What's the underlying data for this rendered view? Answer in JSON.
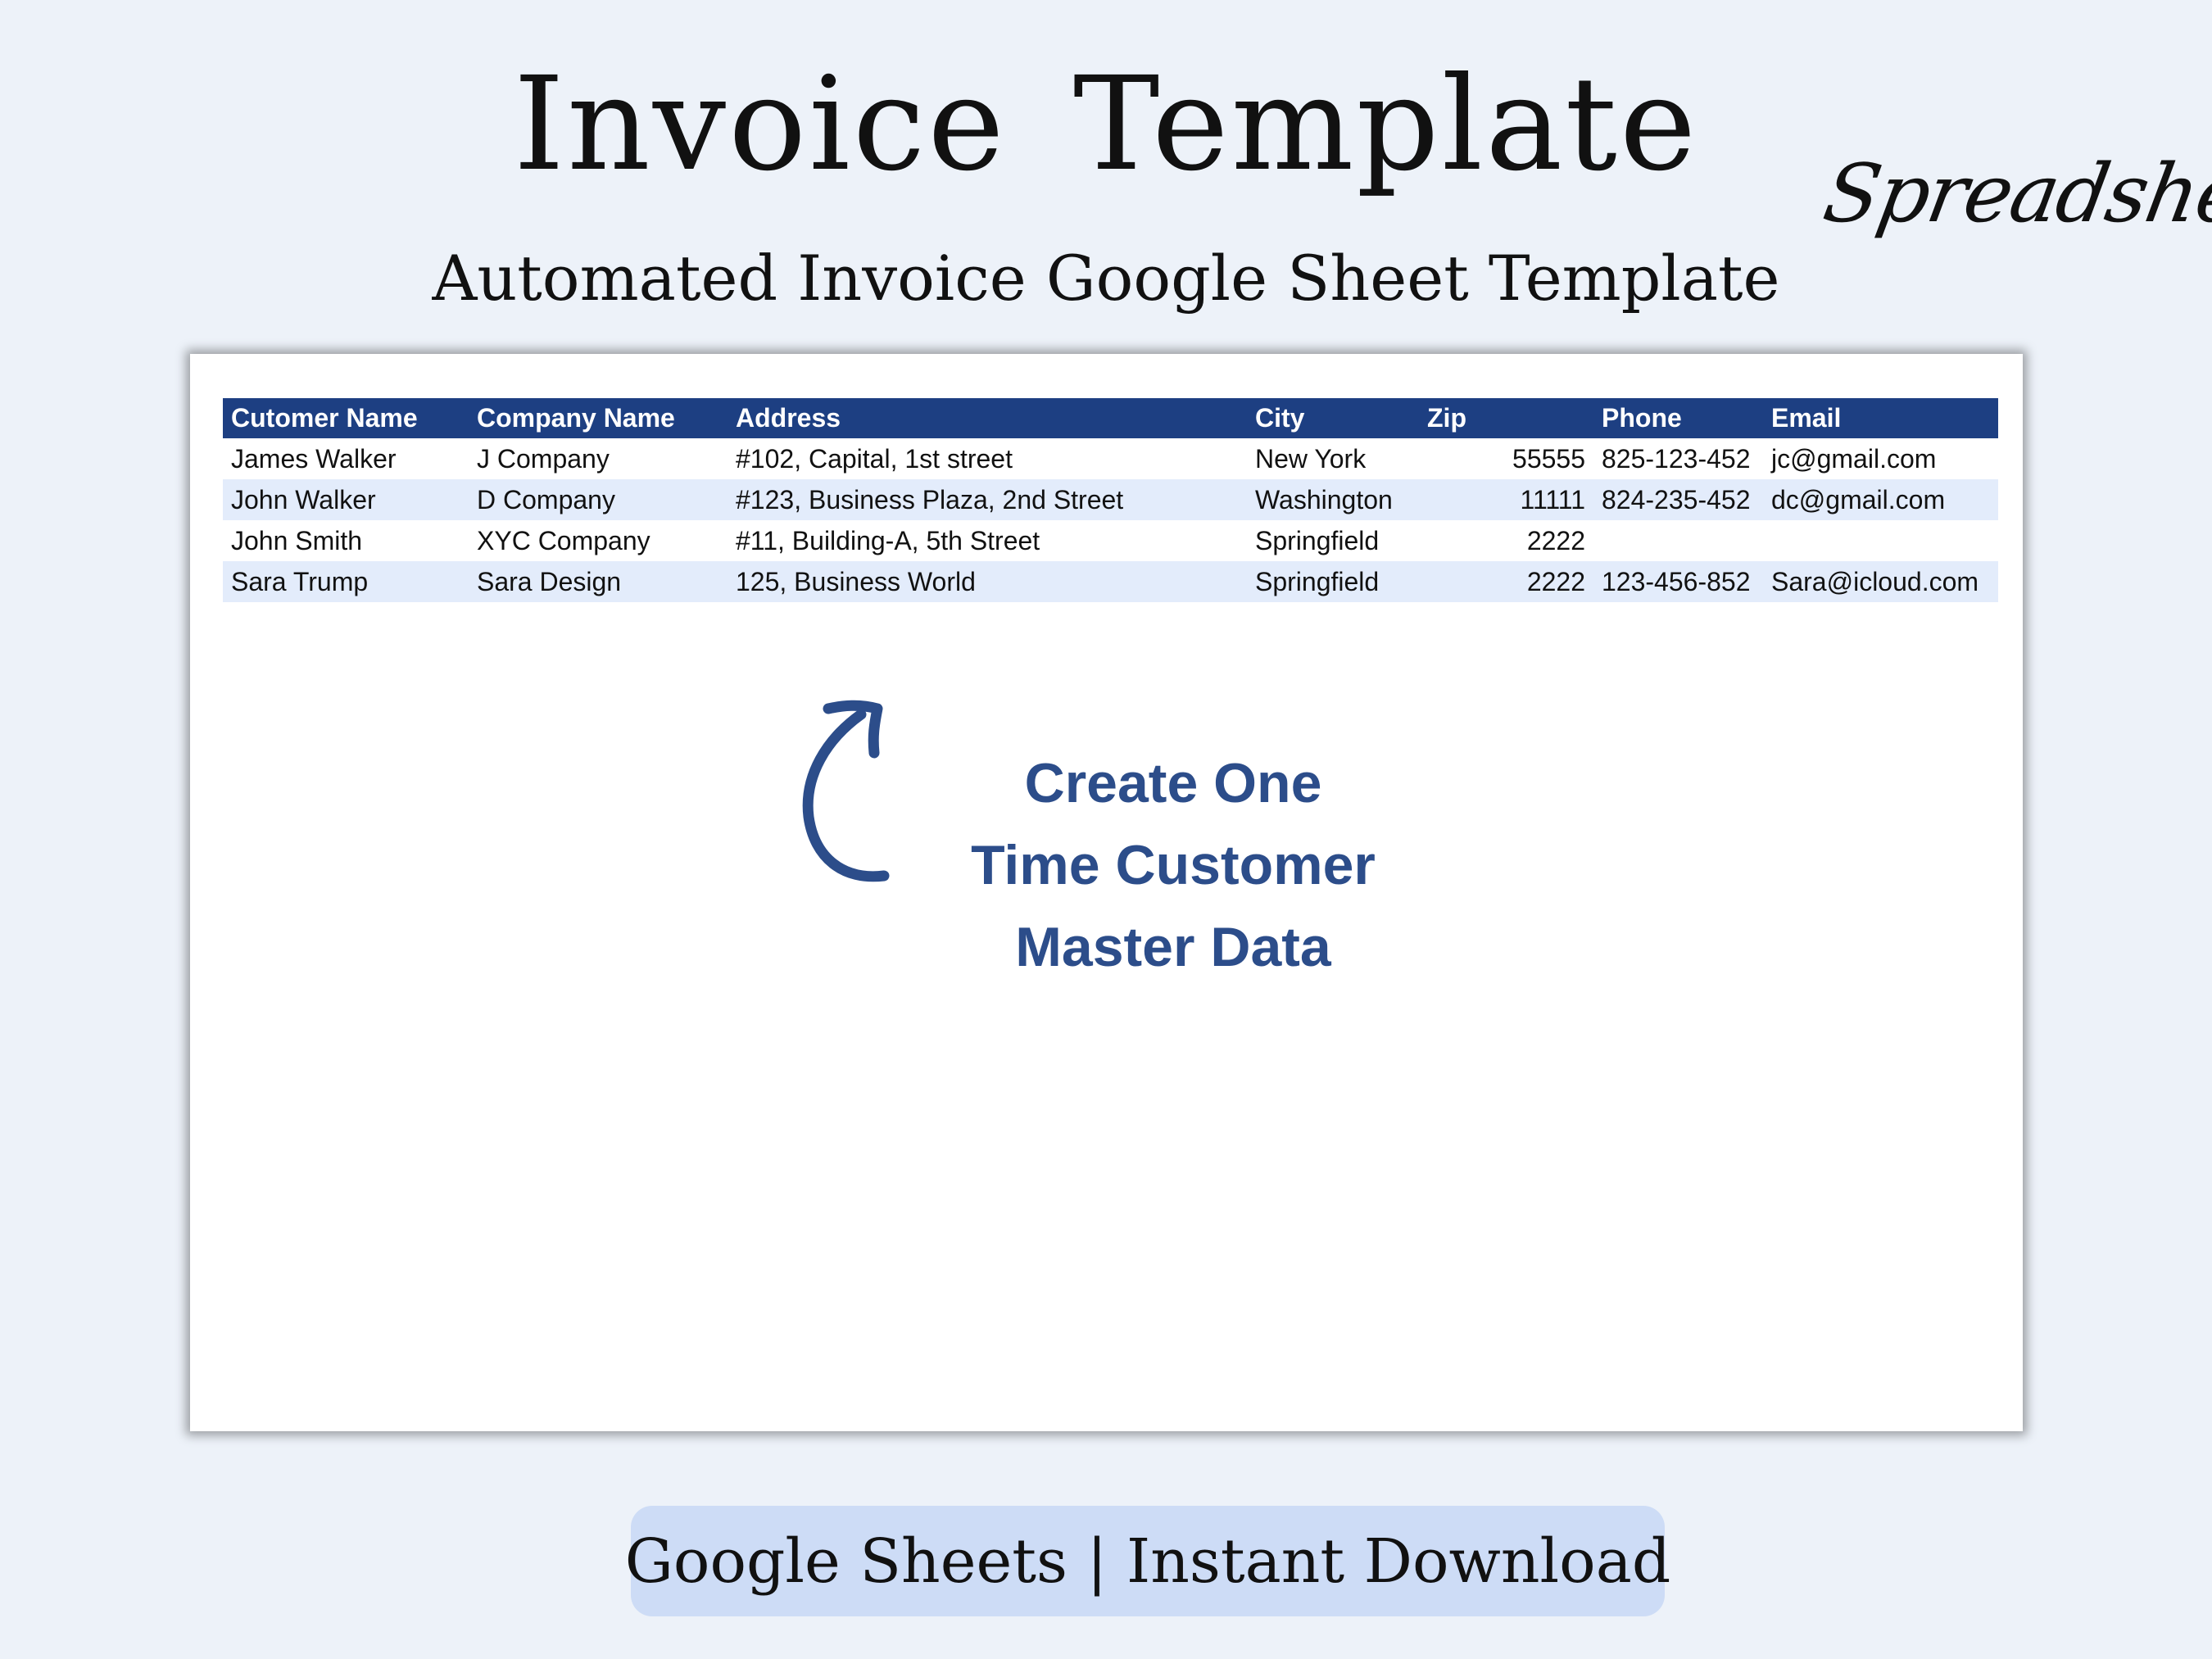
{
  "header": {
    "title": "Invoice  Template",
    "subtitle": "Automated Invoice Google Sheet Template",
    "brand": "Spreadsheets"
  },
  "table": {
    "columns": [
      "Cutomer Name",
      "Company Name",
      "Address",
      "City",
      "Zip",
      "Phone",
      "Email"
    ],
    "rows": [
      {
        "customer": "James Walker",
        "company": "J Company",
        "address": "#102, Capital, 1st street",
        "city": "New York",
        "zip": "55555",
        "phone": "825-123-452",
        "email": "jc@gmail.com"
      },
      {
        "customer": "John Walker",
        "company": "D Company",
        "address": "#123, Business Plaza, 2nd Street",
        "city": "Washington",
        "zip": "11111",
        "phone": "824-235-452",
        "email": "dc@gmail.com"
      },
      {
        "customer": "John Smith",
        "company": "XYC Company",
        "address": "#11, Building-A, 5th Street",
        "city": "Springfield",
        "zip": "2222",
        "phone": "",
        "email": ""
      },
      {
        "customer": "Sara Trump",
        "company": "Sara Design",
        "address": "125, Business World",
        "city": "Springfield",
        "zip": "2222",
        "phone": "123-456-852",
        "email": "Sara@icloud.com"
      }
    ]
  },
  "callout": {
    "lines": [
      "Create One",
      "Time Customer",
      "Master Data"
    ],
    "icon": "curved-arrow-icon",
    "color": "#2c4d8a"
  },
  "footer": {
    "badge": "Google Sheets | Instant Download"
  },
  "colors": {
    "background": "#edf2f9",
    "header_fill": "#1d3f82",
    "alt_row": "#e3ecfb",
    "badge_fill": "#cddcf6"
  }
}
